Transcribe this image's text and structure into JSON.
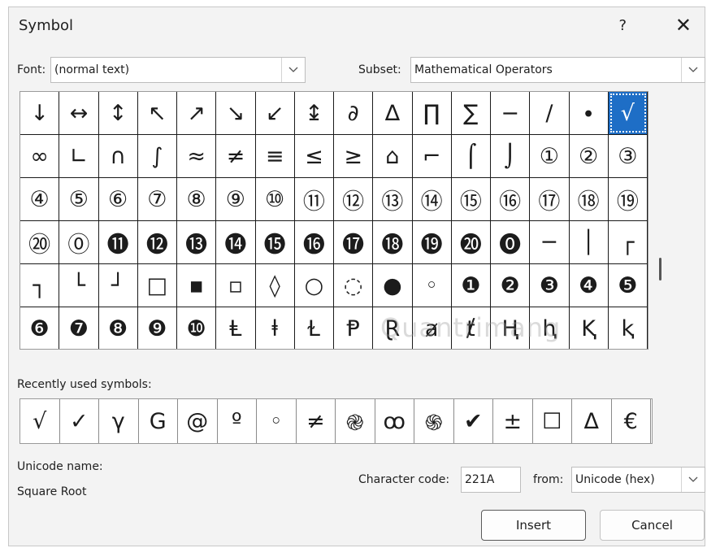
{
  "dialog": {
    "title": "Symbol",
    "help": "?",
    "close": "✕"
  },
  "font": {
    "label": "Font:",
    "value": "(normal text)"
  },
  "subset": {
    "label": "Subset:",
    "value": "Mathematical Operators"
  },
  "grid": {
    "rows": [
      [
        "↓",
        "↔",
        "↕",
        "↖",
        "↗",
        "↘",
        "↙",
        "↨",
        "∂",
        "∆",
        "∏",
        "∑",
        "−",
        "∕",
        "∙",
        "√"
      ],
      [
        "∞",
        "∟",
        "∩",
        "∫",
        "≈",
        "≠",
        "≡",
        "≤",
        "≥",
        "⌂",
        "⌐",
        "⌠",
        "⌡",
        "①",
        "②",
        "③"
      ],
      [
        "④",
        "⑤",
        "⑥",
        "⑦",
        "⑧",
        "⑨",
        "⑩",
        "⑪",
        "⑫",
        "⑬",
        "⑭",
        "⑮",
        "⑯",
        "⑰",
        "⑱",
        "⑲"
      ],
      [
        "⑳",
        "⓪",
        "⓫",
        "⓬",
        "⓭",
        "⓮",
        "⓯",
        "⓰",
        "⓱",
        "⓲",
        "⓳",
        "⓴",
        "⓿",
        "─",
        "│",
        "┌"
      ],
      [
        "┐",
        "└",
        "┘",
        "□",
        "▪",
        "▫",
        "◊",
        "○",
        "◌",
        "●",
        "◦",
        "❶",
        "❷",
        "❸",
        "❹",
        "❺"
      ],
      [
        "❻",
        "❼",
        "❽",
        "❾",
        "❿",
        "Ⱡ",
        "ⱡ",
        "Ɫ",
        "Ᵽ",
        "Ɽ",
        "ⱥ",
        "ⱦ",
        "Ⱨ",
        "ⱨ",
        "Ⱪ",
        "ⱪ"
      ]
    ],
    "selected": "√"
  },
  "recent": {
    "label": "Recently used symbols:",
    "symbols": [
      "√",
      "✓",
      "γ",
      "G",
      "@",
      "º",
      "◦",
      "≠",
      "֎",
      "ꝏ",
      "֍",
      "✔",
      "±",
      "☐",
      "Δ",
      "€"
    ]
  },
  "unicode": {
    "label": "Unicode name:",
    "name": "Square Root"
  },
  "charcode": {
    "label": "Character code:",
    "value": "221A"
  },
  "from": {
    "label": "from:",
    "value": "Unicode (hex)"
  },
  "buttons": {
    "insert": "Insert",
    "cancel": "Cancel"
  },
  "watermark": "Quantrimang"
}
